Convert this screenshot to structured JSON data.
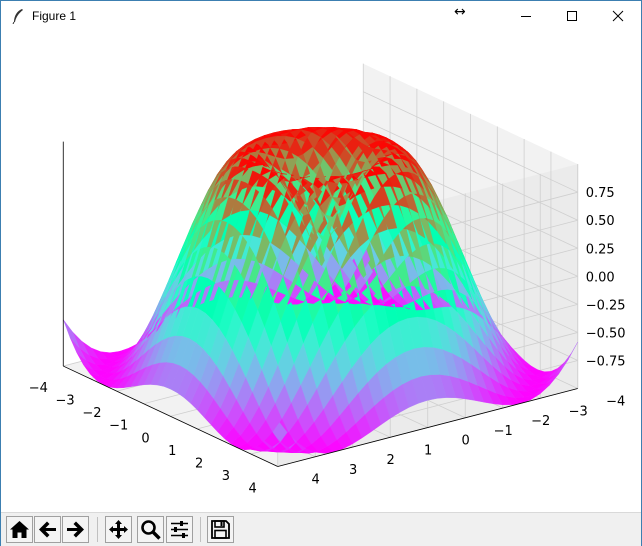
{
  "window": {
    "title": "Figure 1",
    "resize_glyph": "↔",
    "controls": [
      "minimize-icon",
      "maximize-icon",
      "close-icon"
    ]
  },
  "toolbar": {
    "buttons": [
      "home-icon",
      "back-arrow-icon",
      "forward-arrow-icon",
      "pan-icon",
      "zoom-icon",
      "subplots-icon",
      "save-icon"
    ]
  },
  "chart_data": {
    "type": "surface",
    "title": "",
    "function": "z = sin(sqrt(x^2 + y^2))",
    "colormap": "rainbow",
    "x": {
      "range": [
        -4,
        4
      ],
      "step": 0.25
    },
    "y": {
      "range": [
        -4,
        4
      ],
      "step": 0.25
    },
    "x_ticks": [
      "−4",
      "−3",
      "−2",
      "−1",
      "0",
      "1",
      "2",
      "3",
      "4"
    ],
    "y_ticks": [
      "−4",
      "−3",
      "−2",
      "−1",
      "0",
      "1",
      "2",
      "3",
      "4"
    ],
    "z_ticks": [
      "−0.75",
      "−0.50",
      "−0.25",
      "0.00",
      "0.25",
      "0.50",
      "0.75"
    ],
    "zlim": [
      -1,
      1
    ],
    "grid": true
  }
}
